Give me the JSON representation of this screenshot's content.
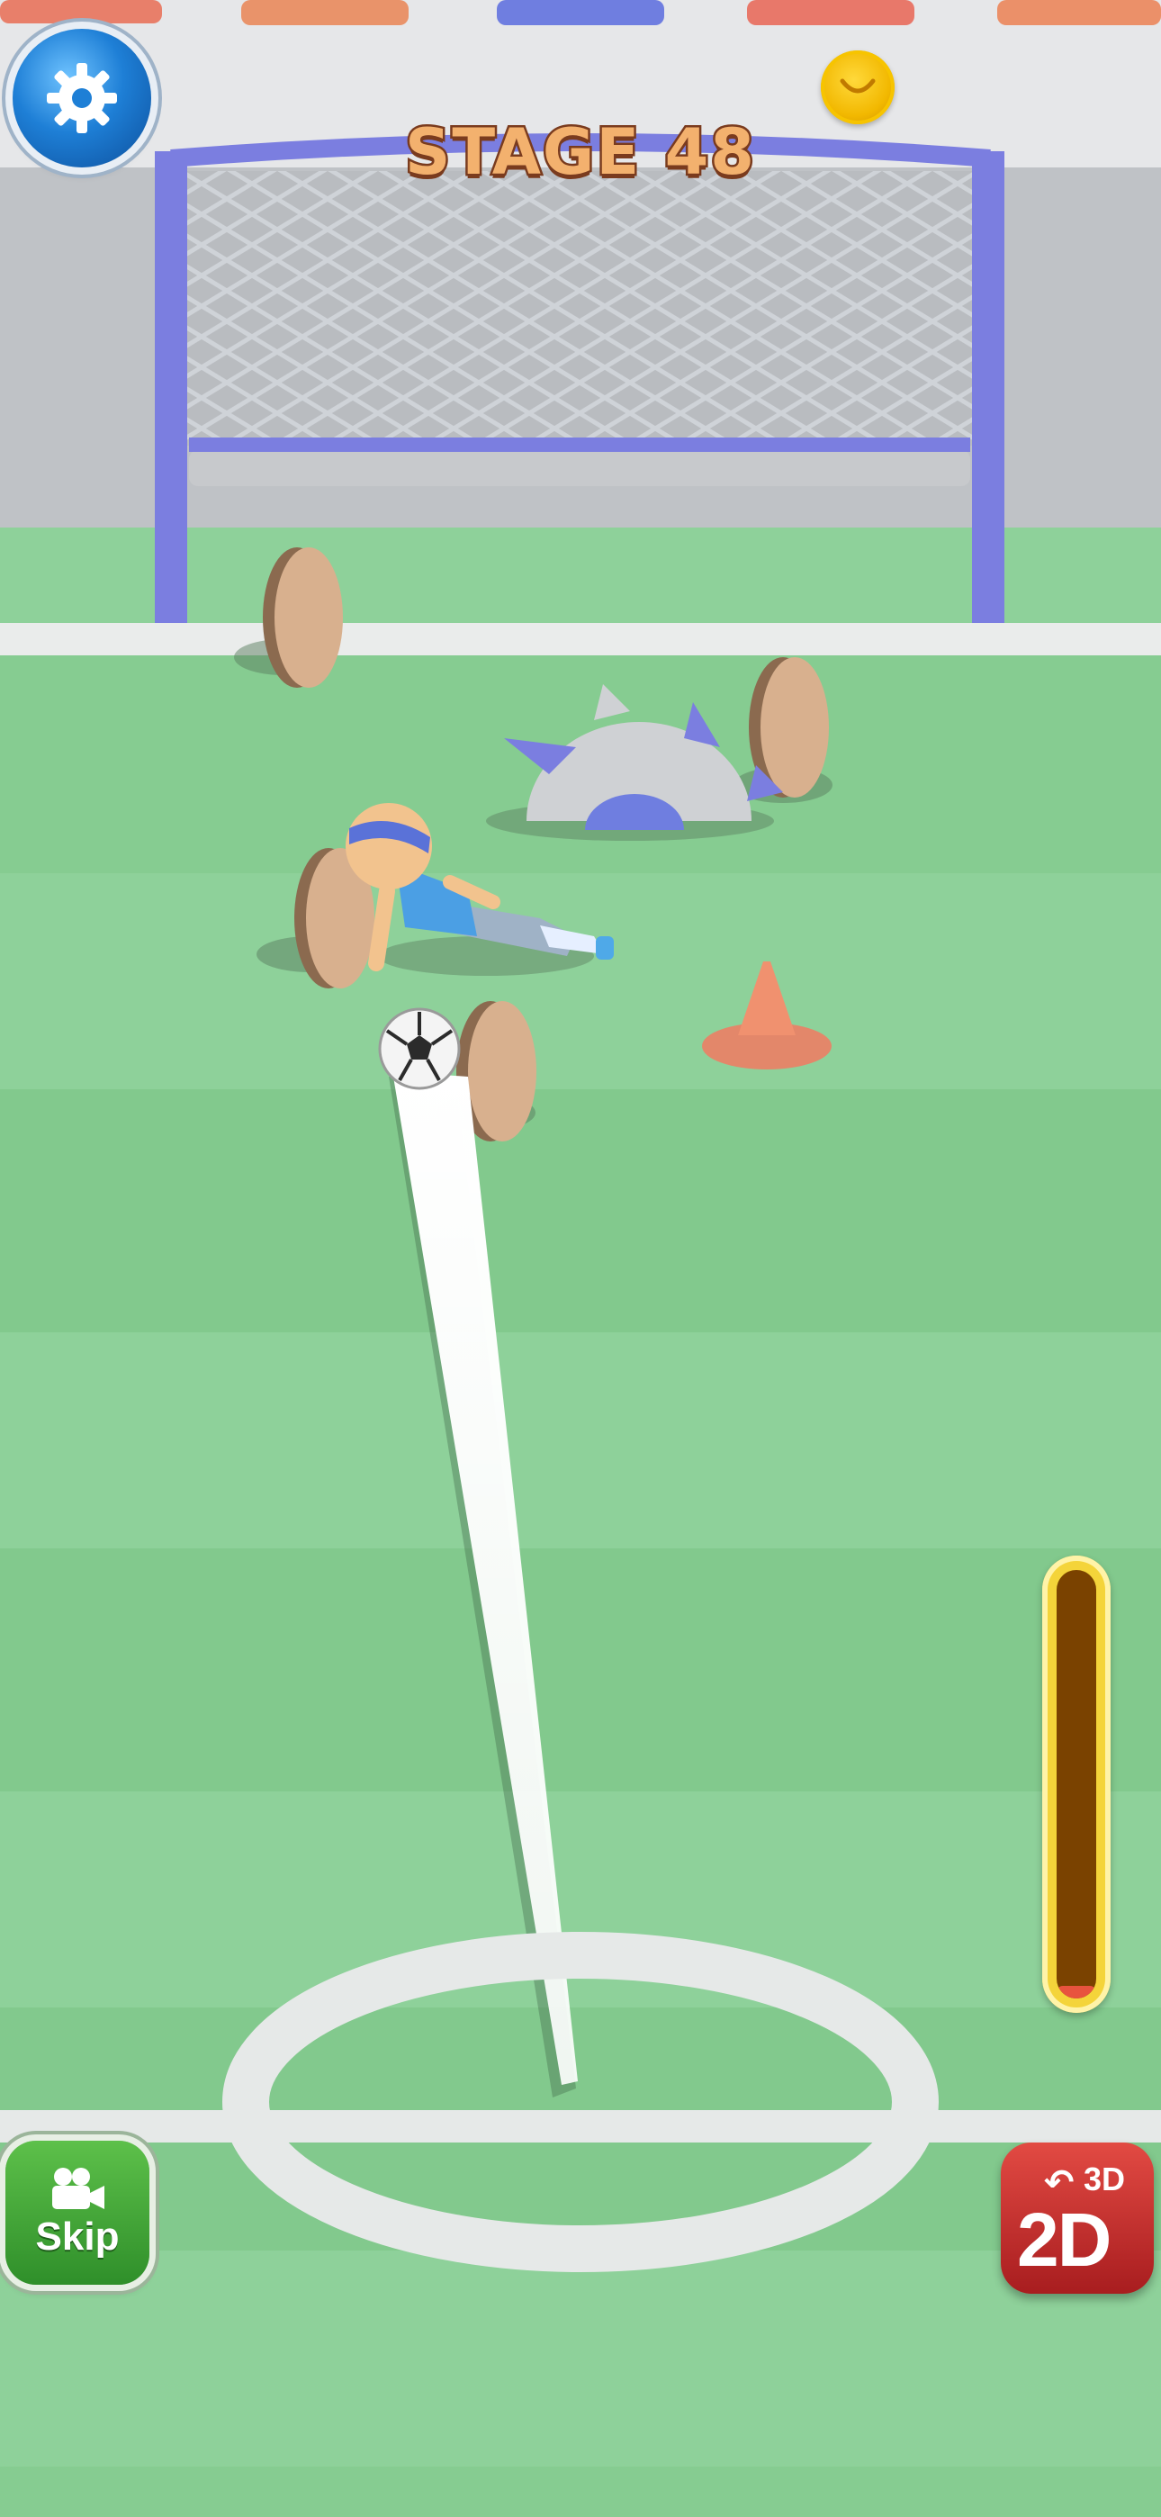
{
  "hud": {
    "stage_title": "STAGE 48",
    "skip_label": "Skip",
    "view_toggle_top": "3D",
    "view_toggle_main": "2D",
    "power_level": 0.03
  },
  "icons": {
    "settings": "gear-icon",
    "coin": "coin-icon",
    "skip": "video-camera-icon",
    "view_toggle": "rotate-arrow-icon"
  },
  "colors": {
    "field_light": "#8fd09c",
    "field_dark": "#84c98f",
    "goal_frame": "#7b7ee0",
    "settings_button": "#1e7fd6",
    "skip_button": "#3fa535",
    "view_toggle_button": "#c9302c",
    "power_meter_border": "#f4d43a",
    "power_meter_fill": "#e8533e",
    "stage_title": "#f3b16e"
  }
}
